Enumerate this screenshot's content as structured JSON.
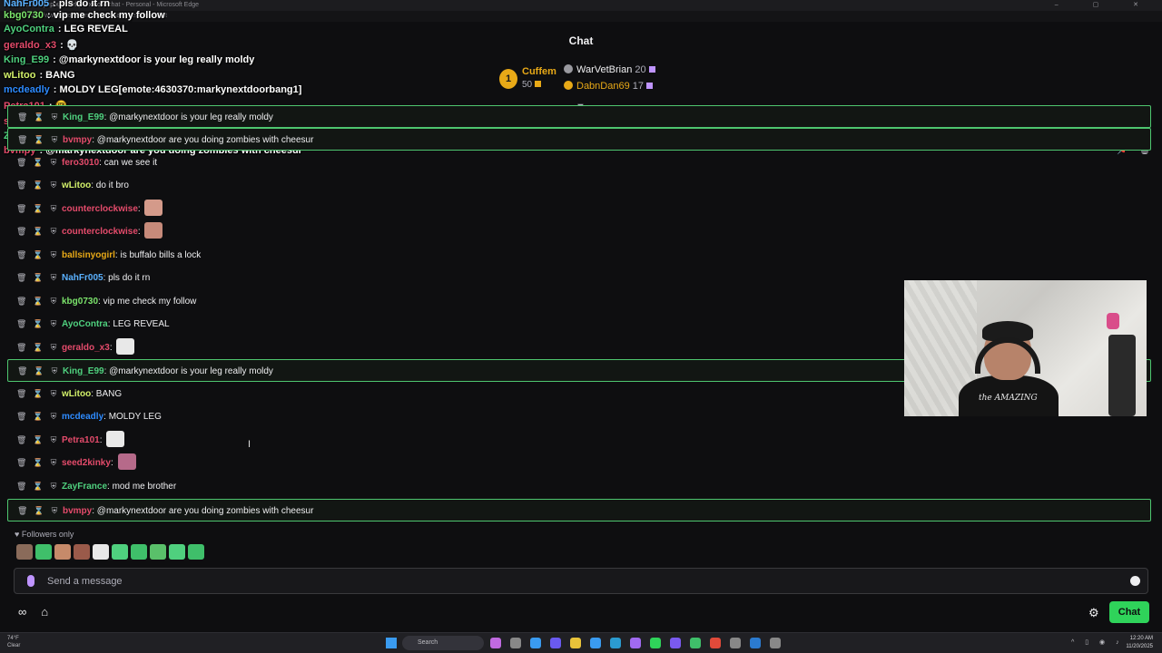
{
  "window": {
    "title": "tiktok.com/popout/markynextdoor/chat - Personal - Microsoft Edge",
    "url": "https://www.tiktok.com/popout/markynextdoor/chat"
  },
  "overlay": [
    {
      "user": "NahFr005",
      "msg": "pls do it rn",
      "color": "#5ab1ff"
    },
    {
      "user": "kbg0730",
      "msg": "vip me check my follow",
      "color": "#7be36b"
    },
    {
      "user": "AyoContra",
      "msg": "LEG REVEAL",
      "color": "#4fd07e"
    },
    {
      "user": "geraldo_x3",
      "msg": "💀",
      "color": "#e44b6b"
    },
    {
      "user": "King_E99",
      "msg": "@markynextdoor is your leg really moldy",
      "color": "#4fd07e"
    },
    {
      "user": "wLitoo",
      "msg": "BANG",
      "color": "#d2f06a"
    },
    {
      "user": "mcdeadly",
      "msg": "MOLDY LEG[emote:4630370:markynextdoorbang1]",
      "color": "#2e8bff"
    },
    {
      "user": "Petra101",
      "msg": "🤓",
      "color": "#e44b6b"
    },
    {
      "user": "seed2kinky",
      "msg": "✌",
      "color": "#e44b6b"
    },
    {
      "user": "ZayFrance",
      "msg": "mod me brother",
      "color": "#4fd07e"
    },
    {
      "user": "bvmpy",
      "msg": "@markynextdoor are you doing zombies with cheesur",
      "color": "#e44b6b"
    }
  ],
  "header": {
    "title": "Chat"
  },
  "leaderboard": {
    "first": {
      "rank": "1",
      "name": "Cuffem",
      "points": "50"
    },
    "second": {
      "name": "WarVetBrian",
      "points": "20"
    },
    "third": {
      "name": "DabnDan69",
      "points": "17"
    }
  },
  "chat": [
    {
      "user": "King_E99",
      "msg": "@markynextdoor is your leg really moldy",
      "color": "#4fd07e",
      "hl": true
    },
    {
      "user": "bvmpy",
      "msg": "@markynextdoor are you doing zombies with cheesur",
      "color": "#e44b6b",
      "hl": true
    },
    {
      "user": "fero3010",
      "msg": "can we see it",
      "color": "#e44b6b",
      "hl": false
    },
    {
      "user": "wLitoo",
      "msg": "do it bro",
      "color": "#d2f06a",
      "hl": false
    },
    {
      "user": "counterclockwise",
      "msg": "",
      "color": "#e44b6b",
      "hl": false
    },
    {
      "user": "counterclockwise",
      "msg": "",
      "color": "#e44b6b",
      "hl": false
    },
    {
      "user": "ballsinyogirl",
      "msg": "is buffalo bills a lock",
      "color": "#e8a917",
      "hl": false
    },
    {
      "user": "NahFr005",
      "msg": "pls do it rn",
      "color": "#5ab1ff",
      "hl": false
    },
    {
      "user": "kbg0730",
      "msg": "vip me check my follow",
      "color": "#7be36b",
      "hl": false
    },
    {
      "user": "AyoContra",
      "msg": "LEG REVEAL",
      "color": "#4fd07e",
      "hl": false
    },
    {
      "user": "geraldo_x3",
      "msg": "",
      "color": "#e44b6b",
      "hl": false
    },
    {
      "user": "King_E99",
      "msg": "@markynextdoor is your leg really moldy",
      "color": "#4fd07e",
      "hl": true
    },
    {
      "user": "wLitoo",
      "msg": "BANG",
      "color": "#d2f06a",
      "hl": false
    },
    {
      "user": "mcdeadly",
      "msg": "MOLDY LEG",
      "color": "#2e8bff",
      "hl": false
    },
    {
      "user": "Petra101",
      "msg": "",
      "color": "#e44b6b",
      "hl": false
    },
    {
      "user": "seed2kinky",
      "msg": "",
      "color": "#e44b6b",
      "hl": false
    },
    {
      "user": "ZayFrance",
      "msg": "mod me brother",
      "color": "#4fd07e",
      "hl": false
    },
    {
      "user": "bvmpy",
      "msg": "@markynextdoor are you doing zombies with cheesur",
      "color": "#e44b6b",
      "hl": true
    }
  ],
  "webcam": {
    "shirt_text": "the AMAZING"
  },
  "footer": {
    "followers_only": "Followers only",
    "input_placeholder": "Send a message",
    "chat_button": "Chat"
  },
  "taskbar": {
    "weather_temp": "74°F",
    "weather_desc": "Clear",
    "search": "Search",
    "time": "12:20 AM",
    "date": "11/20/2025"
  },
  "colors": {
    "accent": "#2fd35a",
    "highlight_border": "#4ec66f",
    "gold": "#e8a917",
    "purple": "#bf94ff"
  }
}
